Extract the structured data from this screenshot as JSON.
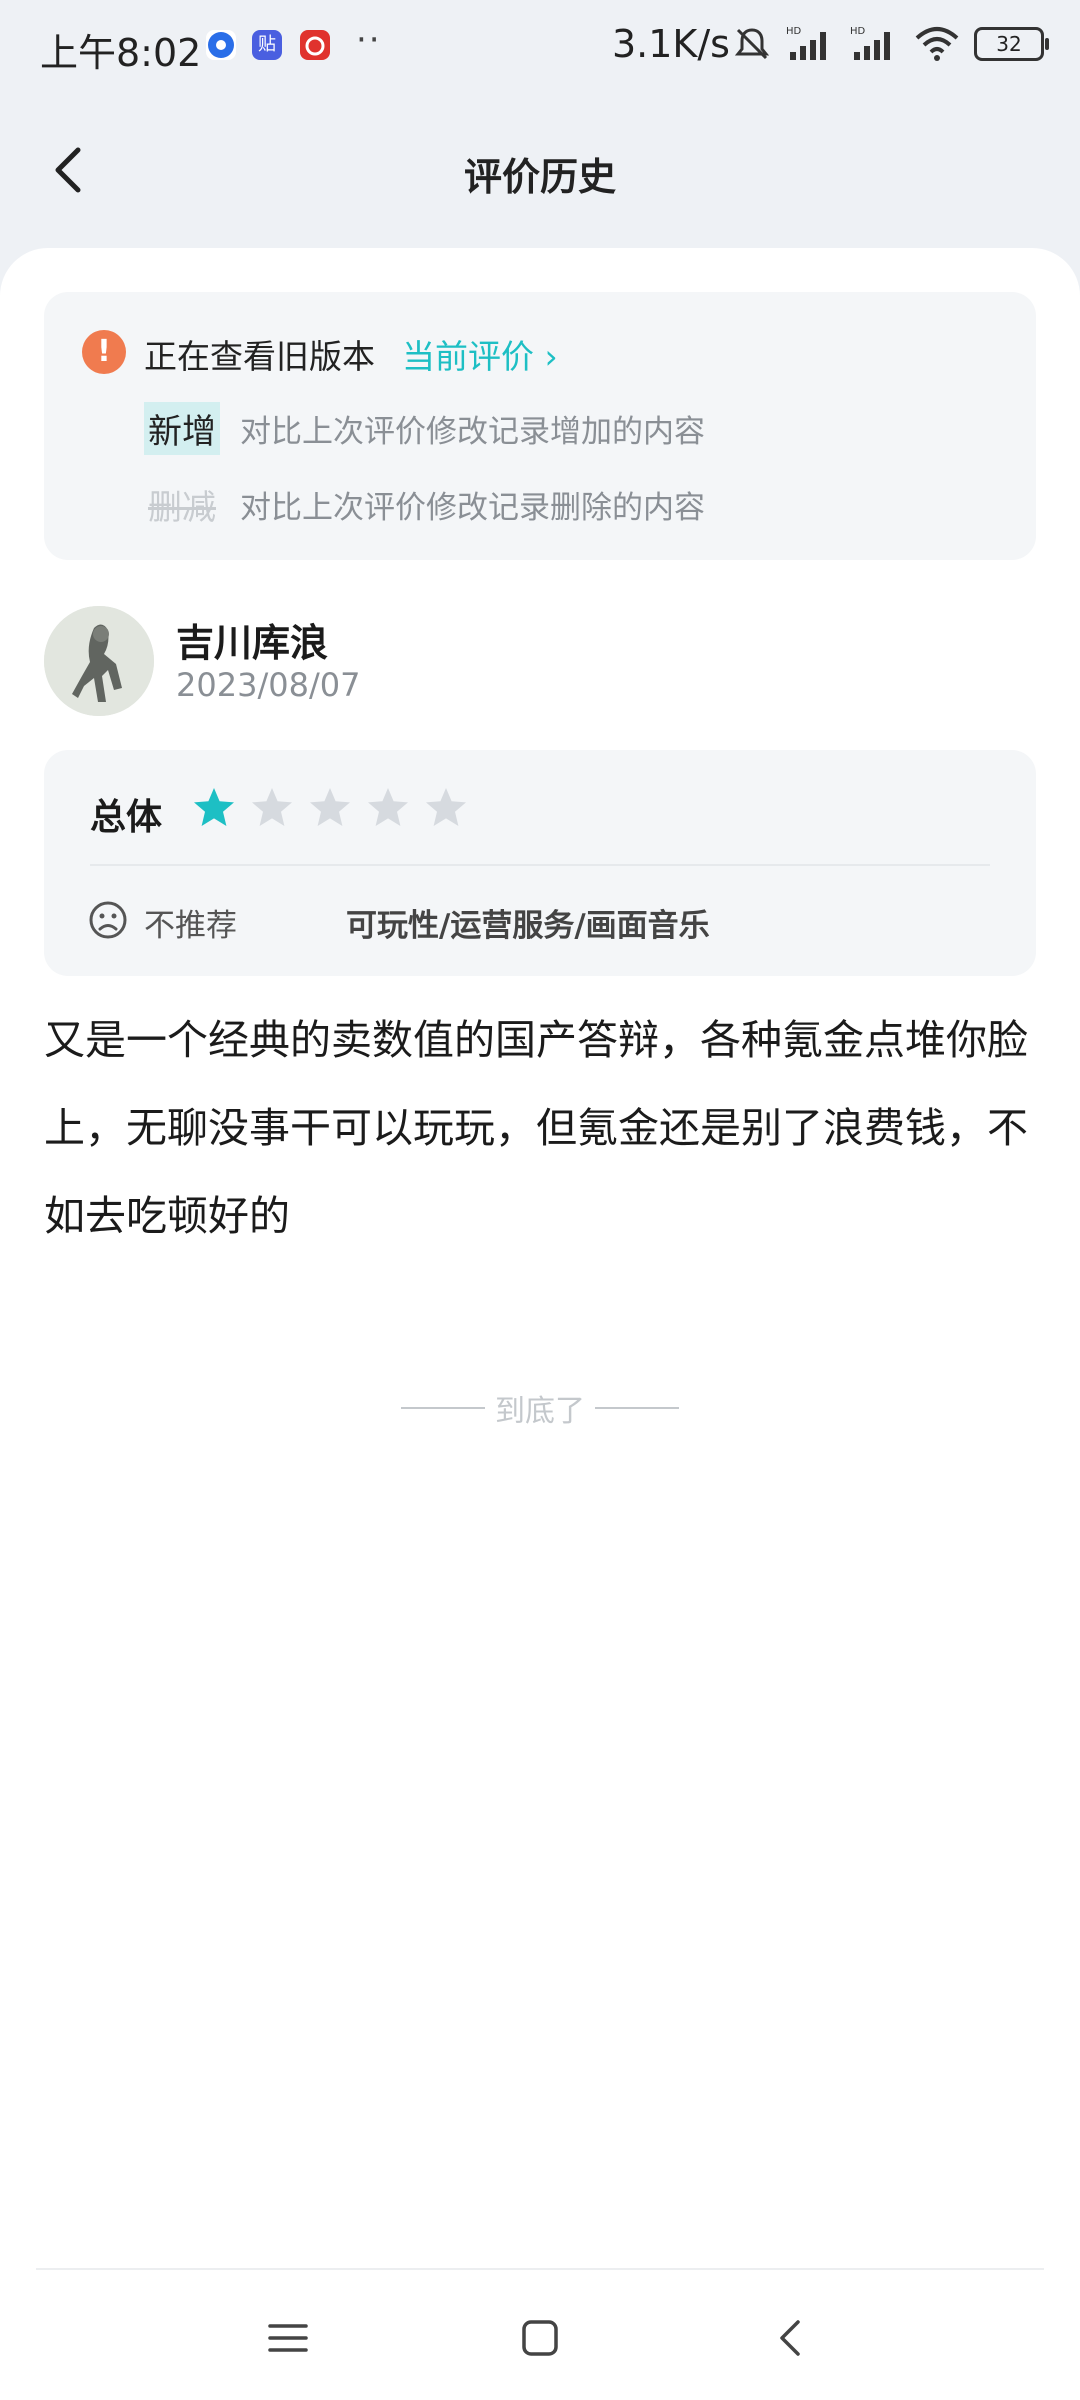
{
  "status_bar": {
    "time": "上午8:02",
    "network_speed": "3.1K/s",
    "battery": "32",
    "dots": "··"
  },
  "header": {
    "title": "评价历史"
  },
  "notice": {
    "text": "正在查看旧版本",
    "link": "当前评价 ›",
    "legend": [
      {
        "tag": "新增",
        "desc": "对比上次评价修改记录增加的内容"
      },
      {
        "tag": "删减",
        "desc": "对比上次评价修改记录删除的内容"
      }
    ]
  },
  "reviewer": {
    "name": "吉川库浪",
    "date": "2023/08/07"
  },
  "rating": {
    "label": "总体",
    "stars": 1,
    "max_stars": 5,
    "sentiment": "不推荐",
    "aspects": "可玩性/运营服务/画面音乐",
    "colors": {
      "filled_star": "#1dbfc4",
      "empty_star": "#d6dadf"
    }
  },
  "review": {
    "text": "又是一个经典的卖数值的国产答辩，各种氪金点堆你脸上，无聊没事干可以玩玩，但氪金还是别了浪费钱，不如去吃顿好的"
  },
  "end_marker": "到底了"
}
